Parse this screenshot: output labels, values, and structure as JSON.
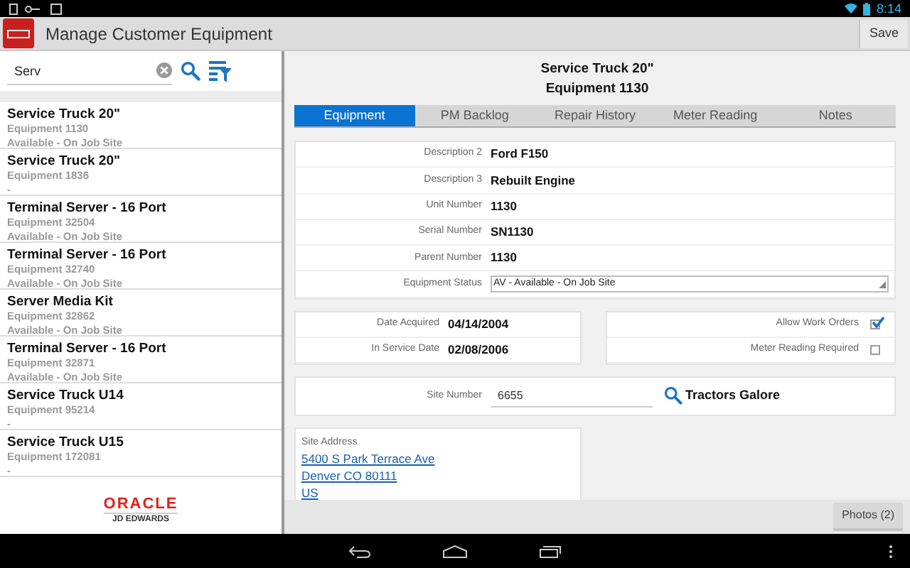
{
  "status_bar": {
    "time": "8:14"
  },
  "header": {
    "title": "Manage Customer Equipment",
    "save_button": "Save"
  },
  "search": {
    "value": "Serv"
  },
  "equipment_list": [
    {
      "name": "Service Truck 20\"",
      "number": "Equipment 1130",
      "status": "Available - On Job Site"
    },
    {
      "name": "Service Truck 20\"",
      "number": "Equipment 1836",
      "status": "-"
    },
    {
      "name": "Terminal Server - 16 Port",
      "number": "Equipment 32504",
      "status": "Available - On Job Site"
    },
    {
      "name": "Terminal Server - 16 Port",
      "number": "Equipment 32740",
      "status": "Available - On Job Site"
    },
    {
      "name": "Server Media Kit",
      "number": "Equipment 32862",
      "status": "Available - On Job Site"
    },
    {
      "name": "Terminal Server - 16 Port",
      "number": "Equipment 32871",
      "status": "Available - On Job Site"
    },
    {
      "name": "Service Truck U14",
      "number": "Equipment 95214",
      "status": "-"
    },
    {
      "name": "Service Truck U15",
      "number": "Equipment 172081",
      "status": "-"
    }
  ],
  "footer_logo": {
    "brand": "ORACLE",
    "product": "JD EDWARDS"
  },
  "detail": {
    "title": "Service Truck 20\"",
    "subtitle": "Equipment 1130",
    "tabs": [
      {
        "label": "Equipment",
        "selected": true
      },
      {
        "label": "PM Backlog",
        "selected": false
      },
      {
        "label": "Repair History",
        "selected": false
      },
      {
        "label": "Meter Reading",
        "selected": false
      },
      {
        "label": "Notes",
        "selected": false
      }
    ],
    "fields": [
      {
        "label": "Description 2",
        "value": "Ford F150",
        "kind": "text"
      },
      {
        "label": "Description 3",
        "value": "Rebuilt Engine",
        "kind": "text"
      },
      {
        "label": "Unit Number",
        "value": "1130",
        "kind": "text"
      },
      {
        "label": "Serial Number",
        "value": "SN1130",
        "kind": "text"
      },
      {
        "label": "Parent Number",
        "value": "1130",
        "kind": "text"
      },
      {
        "label": "Equipment Status",
        "value": "AV - Available - On Job Site",
        "kind": "select"
      }
    ],
    "dates": [
      {
        "label": "Date Acquired",
        "value": "04/14/2004"
      },
      {
        "label": "In Service Date",
        "value": "02/08/2006"
      }
    ],
    "flags": [
      {
        "label": "Allow Work Orders",
        "checked": true
      },
      {
        "label": "Meter Reading Required",
        "checked": false
      }
    ],
    "site": {
      "label": "Site Number",
      "value": "6655",
      "name": "Tractors Galore"
    },
    "address": {
      "label": "Site Address",
      "lines": [
        "5400 S Park Terrace Ave",
        "Denver CO 80111",
        "US"
      ]
    }
  },
  "photos_button": "Photos (2)"
}
